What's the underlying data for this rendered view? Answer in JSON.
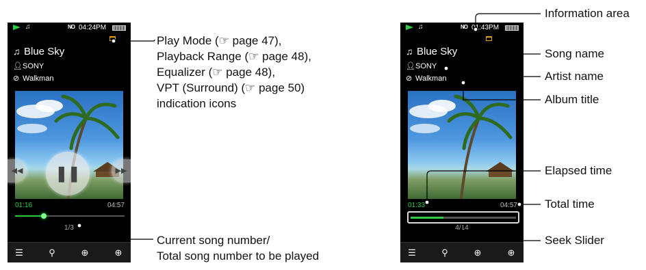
{
  "screen_a": {
    "status": {
      "clock": "04:24PM",
      "format": "NO",
      "battery_icon": "battery-icon",
      "play_icon": "play-indicator-icon",
      "note_icon": "music-note-icon"
    },
    "song": "Blue Sky",
    "artist": "SONY",
    "album": "Walkman",
    "elapsed": "01:16",
    "total": "04:57",
    "progress": 0.26,
    "song_number": "1/3",
    "controls": {
      "prev": "◀◀",
      "pause": "❚❚",
      "next": "▶▶"
    }
  },
  "screen_b": {
    "status": {
      "clock": "01:43PM",
      "format": "NO",
      "battery_icon": "battery-icon",
      "play_icon": "play-indicator-icon",
      "note_icon": "music-note-icon"
    },
    "song": "Blue Sky",
    "artist": "SONY",
    "album": "Walkman",
    "elapsed": "01:33",
    "total": "04:57",
    "progress": 0.31,
    "song_number": "4/14"
  },
  "bottom_bar": {
    "icons": [
      "list-icon",
      "search-icon",
      "globe-icon",
      "add-to-playlist-icon"
    ],
    "glyphs": [
      "☰",
      "⚲",
      "⊕",
      "⊕"
    ]
  },
  "callouts_left": {
    "icons_label": [
      "Play Mode (☞ page 47),",
      "Playback Range (☞ page 48),",
      "Equalizer (☞ page 48),",
      "VPT (Surround) (☞ page 50)",
      "indication icons"
    ],
    "song_number_label": [
      "Current song number/",
      "Total song number to be played"
    ]
  },
  "callouts_right": {
    "information_area": "Information area",
    "song_name": "Song name",
    "artist_name": "Artist name",
    "album_title": "Album title",
    "elapsed_time": "Elapsed time",
    "total_time": "Total time",
    "seek_slider": "Seek Slider"
  },
  "colors": {
    "accent_green": "#2ecc40",
    "folder_orange": "#e6a317",
    "screen_bg": "#000000"
  }
}
